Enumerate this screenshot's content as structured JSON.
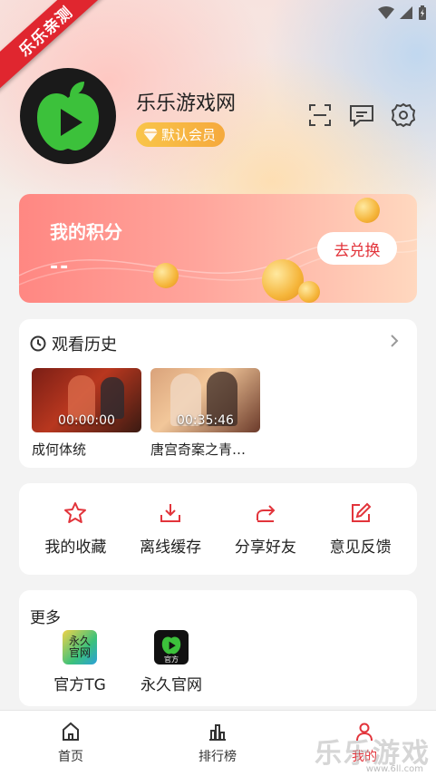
{
  "corner_banner": "乐乐亲测",
  "profile": {
    "username": "乐乐游戏网",
    "member_badge": "默认会员"
  },
  "points": {
    "title": "我的积分",
    "value": "--",
    "redeem_label": "去兑换"
  },
  "history": {
    "title": "观看历史",
    "items": [
      {
        "title": "成何体统",
        "time": "00:00:00"
      },
      {
        "title": "唐宫奇案之青…",
        "time": "00:35:46"
      }
    ]
  },
  "actions": [
    {
      "label": "我的收藏",
      "icon": "star-icon"
    },
    {
      "label": "离线缓存",
      "icon": "download-icon"
    },
    {
      "label": "分享好友",
      "icon": "share-icon"
    },
    {
      "label": "意见反馈",
      "icon": "edit-icon"
    }
  ],
  "more": {
    "title": "更多",
    "items": [
      {
        "label": "官方TG",
        "icon_text": "永久\n官网"
      },
      {
        "label": "永久官网",
        "icon_text": "官方"
      }
    ]
  },
  "tabs": [
    {
      "label": "首页",
      "icon": "home-icon"
    },
    {
      "label": "排行榜",
      "icon": "chart-icon"
    },
    {
      "label": "我的",
      "icon": "profile-icon"
    }
  ],
  "watermark": {
    "text": "乐乐游戏",
    "url": "www.6ll.com"
  },
  "colors": {
    "accent": "#e2343b",
    "badge": "#f5a93c",
    "points_card": "#ff8782"
  }
}
